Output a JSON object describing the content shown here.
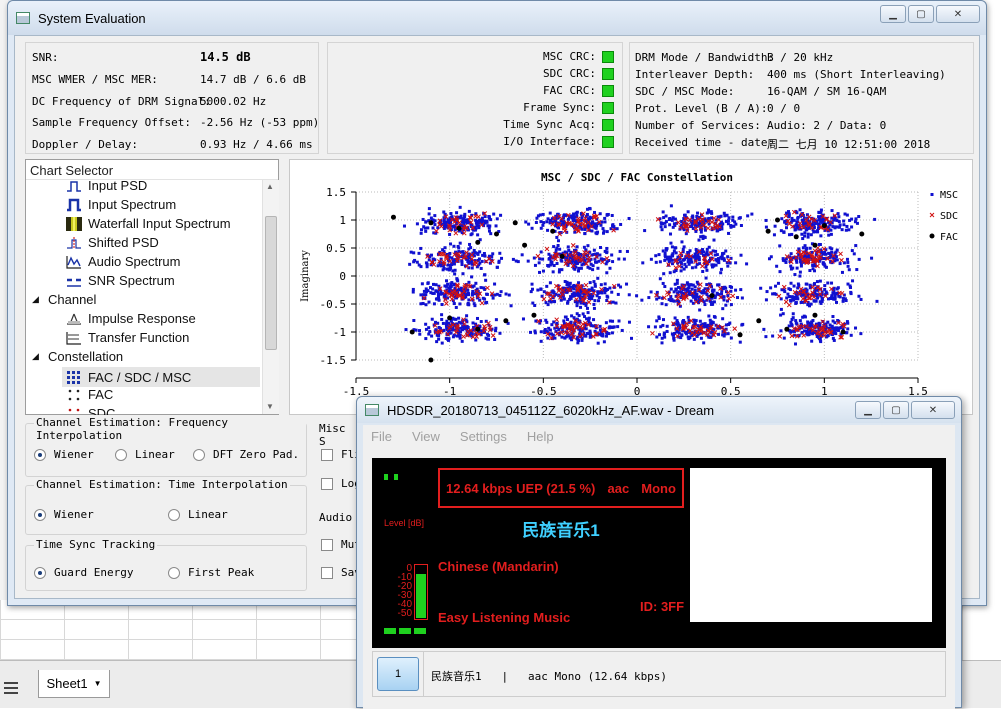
{
  "main_window": {
    "title": "System Evaluation"
  },
  "status": {
    "snr_label": "SNR:",
    "snr_value": "14.5 dB",
    "wmer_label": "MSC WMER / MSC MER:",
    "wmer_value": "14.7 dB / 6.6 dB",
    "dc_label": "DC Frequency of DRM Signal:",
    "dc_value": "5000.02 Hz",
    "sfo_label": "Sample Frequency Offset:",
    "sfo_value": "-2.56 Hz (-53 ppm)",
    "doppler_label": "Doppler / Delay:",
    "doppler_value": "0.93 Hz / 4.66 ms"
  },
  "sync": {
    "items": [
      "MSC CRC:",
      "SDC CRC:",
      "FAC CRC:",
      "Frame Sync:",
      "Time Sync Acq:",
      "I/O Interface:"
    ],
    "led_color": "#1fd11f"
  },
  "drm": {
    "rows": [
      {
        "label": "DRM Mode / Bandwidth:",
        "value": "B / 20 kHz"
      },
      {
        "label": "Interleaver Depth:",
        "value": "400 ms (Short Interleaving)"
      },
      {
        "label": "SDC / MSC Mode:",
        "value": "16-QAM / SM 16-QAM"
      },
      {
        "label": "Prot. Level (B / A):",
        "value": "0 / 0"
      },
      {
        "label": "Number of Services:",
        "value": "Audio: 2 / Data: 0"
      },
      {
        "label": "Received time - date:",
        "value": "周二 七月 10 12:51:00 2018"
      }
    ]
  },
  "chart_selector": {
    "header": "Chart Selector",
    "items": [
      {
        "label": "Input PSD",
        "icon": "psd-icon"
      },
      {
        "label": "Input Spectrum",
        "icon": "spectrum-icon"
      },
      {
        "label": "Waterfall Input Spectrum",
        "icon": "waterfall-icon"
      },
      {
        "label": "Shifted PSD",
        "icon": "shifted-psd-icon"
      },
      {
        "label": "Audio Spectrum",
        "icon": "audio-spectrum-icon"
      },
      {
        "label": "SNR Spectrum",
        "icon": "snr-icon"
      },
      {
        "label": "Channel",
        "icon": "chevron-down-icon"
      },
      {
        "label": "Impulse Response",
        "icon": "impulse-icon"
      },
      {
        "label": "Transfer Function",
        "icon": "transfer-icon"
      },
      {
        "label": "Constellation",
        "icon": "chevron-down-icon"
      },
      {
        "label": "FAC / SDC / MSC",
        "icon": "constellation-icon"
      },
      {
        "label": "FAC",
        "icon": "fac-icon"
      },
      {
        "label": "SDC",
        "icon": "sdc-icon"
      }
    ],
    "selected": "FAC / SDC / MSC"
  },
  "chart_data": {
    "type": "scatter",
    "title": "MSC / SDC / FAC Constellation",
    "ylabel": "Imaginary",
    "xlim": [
      -1.5,
      1.5
    ],
    "ylim": [
      -1.5,
      1.5
    ],
    "x_ticks": [
      "-1.5",
      "-1",
      "-0.5",
      "0",
      "0.5",
      "1",
      "1.5"
    ],
    "y_ticks": [
      "1.5",
      "1",
      "0.5",
      "0",
      "-0.5",
      "-1",
      "-1.5"
    ],
    "grid": true,
    "legend_position": "right",
    "series": [
      {
        "name": "MSC",
        "color": "#1010d0",
        "marker": "square",
        "centers": [
          -0.949,
          -0.316,
          0.316,
          0.949
        ],
        "spread": 0.17
      },
      {
        "name": "SDC",
        "color": "#d01010",
        "marker": "x",
        "centers": [
          -0.949,
          -0.316,
          0.316,
          0.949
        ],
        "spread": 0.12
      },
      {
        "name": "FAC",
        "color": "#000000",
        "marker": "dot",
        "points": [
          [
            -1.3,
            1.05
          ],
          [
            -1.1,
            0.95
          ],
          [
            -0.95,
            0.85
          ],
          [
            -0.75,
            0.75
          ],
          [
            -0.6,
            0.55
          ],
          [
            -0.45,
            0.8
          ],
          [
            -0.65,
            0.95
          ],
          [
            -0.85,
            0.6
          ],
          [
            0.7,
            0.8
          ],
          [
            0.85,
            0.7
          ],
          [
            1.0,
            0.9
          ],
          [
            0.75,
            1.0
          ],
          [
            0.95,
            0.55
          ],
          [
            1.2,
            0.75
          ],
          [
            -1.0,
            -0.75
          ],
          [
            -0.85,
            -0.95
          ],
          [
            -0.7,
            -0.8
          ],
          [
            -1.2,
            -1.0
          ],
          [
            -0.55,
            -0.7
          ],
          [
            0.65,
            -0.8
          ],
          [
            0.8,
            -0.95
          ],
          [
            0.95,
            -0.7
          ],
          [
            1.1,
            -1.0
          ],
          [
            0.55,
            -1.05
          ],
          [
            -1.1,
            -1.5
          ],
          [
            -0.4,
            0.35
          ],
          [
            0.4,
            -0.35
          ]
        ]
      }
    ]
  },
  "options": {
    "freq_interp": {
      "title": "Channel Estimation: Frequency Interpolation",
      "options": [
        "Wiener",
        "Linear",
        "DFT Zero Pad."
      ],
      "selected": 0
    },
    "time_interp": {
      "title": "Channel Estimation: Time Interpolation",
      "options": [
        "Wiener",
        "Linear"
      ],
      "selected": 0
    },
    "time_sync": {
      "title": "Time Sync Tracking",
      "options": [
        "Guard Energy",
        "First Peak"
      ],
      "selected": 0
    },
    "misc_title": "Misc S",
    "misc_items": [
      "Fli",
      "Log"
    ],
    "audio_title": "Audio",
    "audio_items": [
      "Mut",
      "Sav"
    ]
  },
  "dream": {
    "title": "HDSDR_20180713_045112Z_6020kHz_AF.wav - Dream",
    "menu": [
      "File",
      "View",
      "Settings",
      "Help"
    ],
    "bitrate": "12.64 kbps UEP (21.5 %)",
    "codec": "aac",
    "channels": "Mono",
    "station": "民族音乐1",
    "language": "Chinese (Mandarin)",
    "program_type": "Easy Listening Music",
    "id": "ID: 3FF",
    "level_label": "Level [dB]",
    "level_ticks": [
      "0",
      "-10",
      "-20",
      "-30",
      "-40",
      "-50"
    ],
    "level_fill": 0.82,
    "service_button": "1",
    "service_line": "民族音乐1   |   aac Mono (12.64 kbps)"
  },
  "sheet": {
    "tab": "Sheet1"
  }
}
